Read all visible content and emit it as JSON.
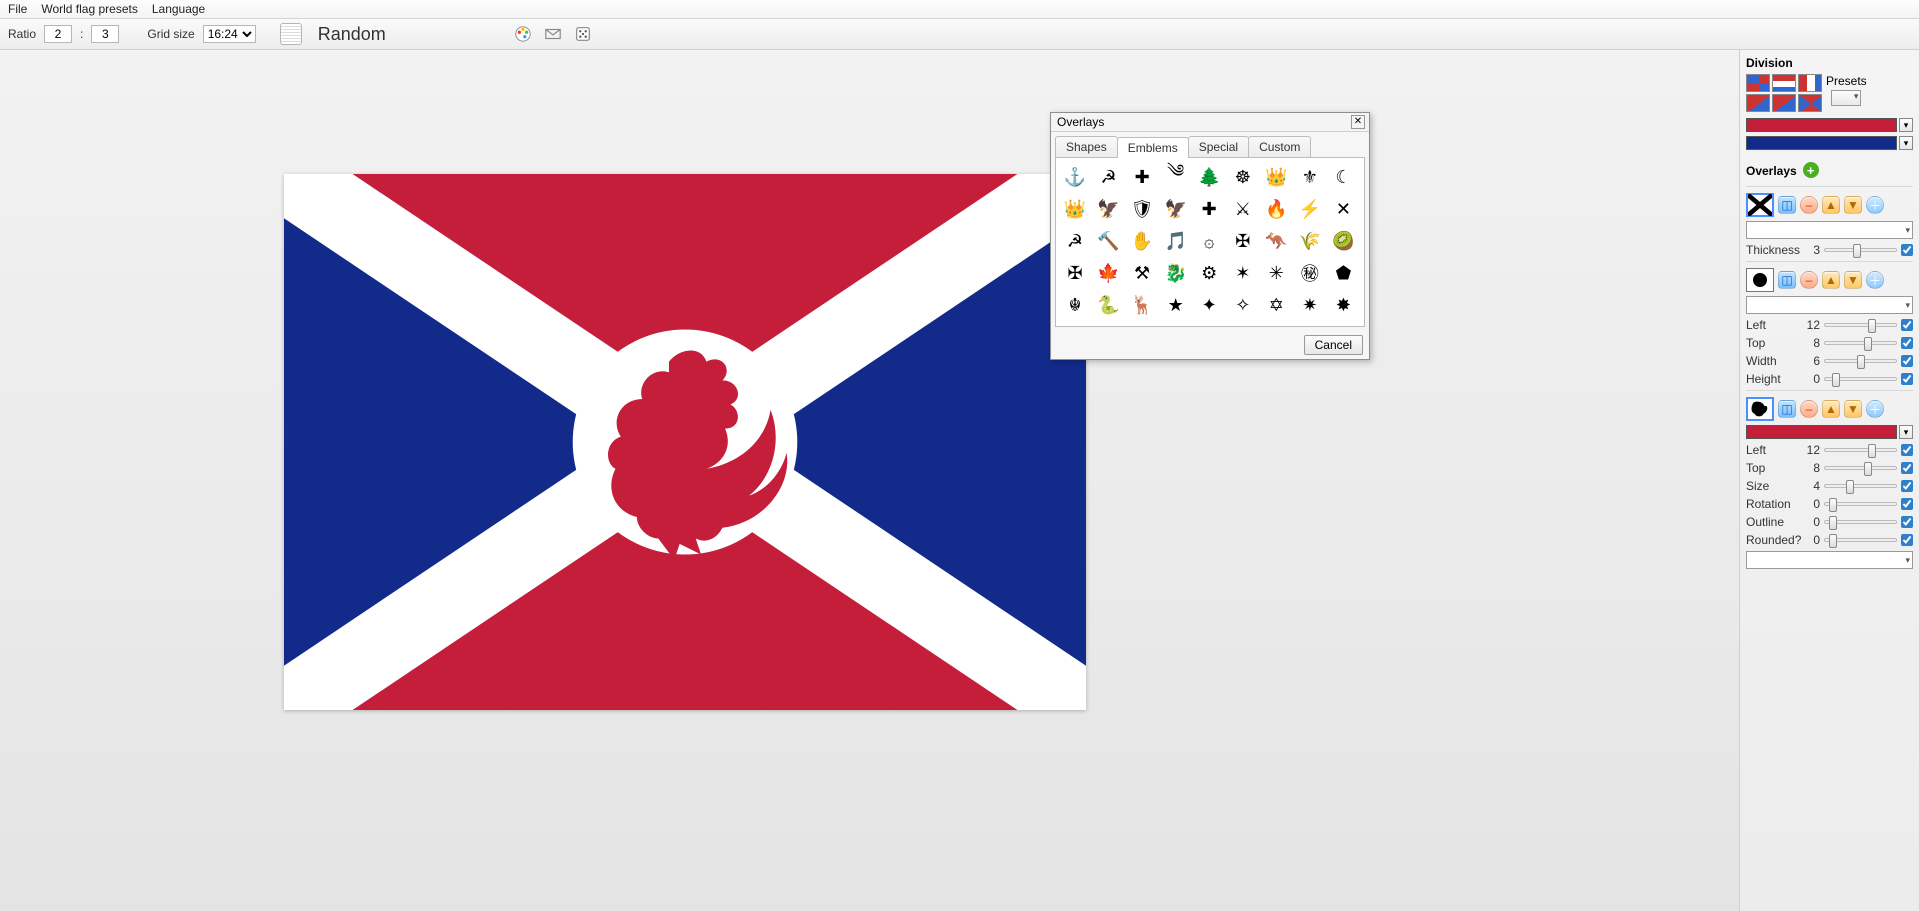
{
  "menu": {
    "file": "File",
    "presets": "World flag presets",
    "language": "Language"
  },
  "toolbar": {
    "ratio_label": "Ratio",
    "ratio_a": "2",
    "ratio_sep": ":",
    "ratio_b": "3",
    "grid_label": "Grid size",
    "grid_value": "16:24",
    "random": "Random"
  },
  "popup": {
    "title": "Overlays",
    "tabs": {
      "shapes": "Shapes",
      "emblems": "Emblems",
      "special": "Special",
      "custom": "Custom"
    },
    "active_tab": "Emblems",
    "cancel": "Cancel",
    "emblems": [
      "⚓",
      "☭",
      "✚",
      "༄",
      "🌲",
      "☸",
      "👑",
      "⚜",
      "☾",
      "👑",
      "🦅",
      "🛡",
      "🦅",
      "✚",
      "⚔",
      "🔥",
      "⚡",
      "✕",
      "☭",
      "🔨",
      "✋",
      "🎵",
      "۞",
      "✠",
      "🦘",
      "🌾",
      "🥝",
      "✠",
      "🍁",
      "⚒",
      "🐉",
      "⚙",
      "✶",
      "✳",
      "㊙",
      "⬟",
      "☬",
      "🐍",
      "🦌",
      "★",
      "✦",
      "✧",
      "✡",
      "✷",
      "✸"
    ]
  },
  "right": {
    "division_title": "Division",
    "presets_label": "Presets",
    "overlays_title": "Overlays",
    "division_colors": [
      "#c41e3a",
      "#122a8a"
    ],
    "overlays": [
      {
        "thumb": "saltire",
        "selected": true,
        "color": null,
        "props": [
          {
            "name": "Thickness",
            "value": "3",
            "knob": 40,
            "chk": true
          }
        ]
      },
      {
        "thumb": "circle",
        "selected": false,
        "color": null,
        "props": [
          {
            "name": "Left",
            "value": "12",
            "knob": 60,
            "chk": true
          },
          {
            "name": "Top",
            "value": "8",
            "knob": 55,
            "chk": true
          },
          {
            "name": "Width",
            "value": "6",
            "knob": 45,
            "chk": true
          },
          {
            "name": "Height",
            "value": "0",
            "knob": 10,
            "chk": true
          }
        ]
      },
      {
        "thumb": "rooster",
        "selected": true,
        "color": "#c41e3a",
        "props": [
          {
            "name": "Left",
            "value": "12",
            "knob": 60,
            "chk": true
          },
          {
            "name": "Top",
            "value": "8",
            "knob": 55,
            "chk": true
          },
          {
            "name": "Size",
            "value": "4",
            "knob": 30,
            "chk": true
          },
          {
            "name": "Rotation",
            "value": "0",
            "knob": 5,
            "chk": true
          },
          {
            "name": "Outline",
            "value": "0",
            "knob": 5,
            "chk": true
          },
          {
            "name": "Rounded?",
            "value": "0",
            "knob": 5,
            "chk": true
          }
        ]
      }
    ]
  },
  "flag": {
    "red": "#c41e3a",
    "blue": "#122a8a",
    "white": "#ffffff"
  }
}
